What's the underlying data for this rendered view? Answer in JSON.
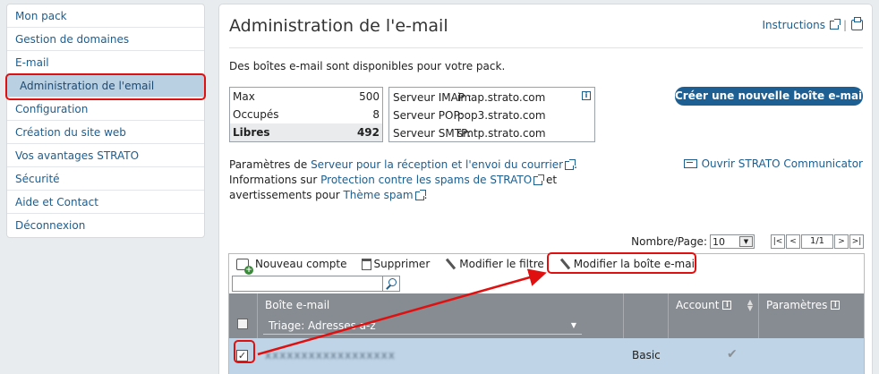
{
  "sidebar": {
    "items": [
      {
        "label": "Mon pack"
      },
      {
        "label": "Gestion de domaines"
      },
      {
        "label": "E-mail"
      },
      {
        "label": "Administration de l'email"
      },
      {
        "label": "Configuration"
      },
      {
        "label": "Création du site web"
      },
      {
        "label": "Vos avantages STRATO"
      },
      {
        "label": "Sécurité"
      },
      {
        "label": "Aide et Contact"
      },
      {
        "label": "Déconnexion"
      }
    ]
  },
  "header": {
    "title": "Administration de l'e-mail",
    "instructions": "Instructions",
    "separator": "|"
  },
  "intro": "Des boîtes e-mail sont disponibles pour votre pack.",
  "stats": [
    {
      "label": "Max",
      "value": "500"
    },
    {
      "label": "Occupés",
      "value": "8"
    },
    {
      "label": "Libres",
      "value": "492"
    }
  ],
  "servers": [
    {
      "label": "Serveur IMAP :",
      "value": "imap.strato.com"
    },
    {
      "label": "Serveur POP:",
      "value": "pop3.strato.com"
    },
    {
      "label": "Serveur SMTP:",
      "value": "smtp.strato.com"
    }
  ],
  "create_button": "Créer une nouvelle boîte e-mail",
  "params": {
    "line1_pre": "Paramètres de ",
    "line1_link": "Serveur pour la réception et l'envoi du courrier",
    "line1_post": ".",
    "line2_pre": "Informations sur ",
    "line2_link": "Protection contre les spams de STRATO",
    "line2_post": " et",
    "line3_pre": "avertissements pour ",
    "line3_link": "Thème spam",
    "line3_post": "."
  },
  "communicator": "Ouvrir STRATO Communicator",
  "pager": {
    "label": "Nombre/Page:",
    "per_page": "10",
    "first": "|<",
    "prev": "<",
    "page": "1/1",
    "next": ">",
    "last": ">|"
  },
  "toolbar": {
    "new_account": "Nouveau compte",
    "delete": "Supprimer",
    "edit_filter": "Modifier le filtre",
    "edit_mailbox": "Modifier la boîte e-mail"
  },
  "search": {
    "value": ""
  },
  "table": {
    "col_email": "Boîte e-mail",
    "sort_label": "Triage: Adresses a-z",
    "col_account": "Account",
    "col_params": "Paramètres",
    "rows": [
      {
        "email": "xxxxxxxxxxxxxxxxxx",
        "account": "Basic",
        "params": "✔",
        "checked": "✓"
      }
    ]
  },
  "colors": {
    "link": "#1b5e90",
    "highlight": "#e01010",
    "header_bg": "#878c92",
    "selected_row": "#bfd4e6"
  }
}
